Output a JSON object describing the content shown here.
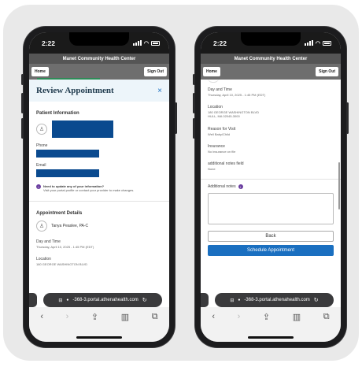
{
  "left": {
    "time": "2:22",
    "app_title": "Manet Community Health Center",
    "home": "Home",
    "sign_out": "Sign Out",
    "review_title": "Review Appointment",
    "close": "×",
    "patient_info": "Patient Information",
    "phone_label": "Phone",
    "email_label": "Email",
    "update_bold": "Need to update any of your information?",
    "update_rest": "Visit your portal profile or contact your provider to make changes.",
    "appt_details": "Appointment Details",
    "provider": "Tanya Peaslee, PA-C",
    "dt_label": "Day and Time",
    "dt_value": "Thursday, April 10, 2025 - 1:45 PM (EDT)",
    "loc_label": "Location",
    "loc_value": "180 GEORGE WASHINGTON BLVD",
    "url": "-368-3.portal.athenahealth.com"
  },
  "right": {
    "time": "2:22",
    "app_title": "Manet Community Health Center",
    "home": "Home",
    "sign_out": "Sign Out",
    "dt_label": "Day and Time",
    "dt_value": "Thursday, April 10, 2025 - 1:45 PM (EDT)",
    "loc_label": "Location",
    "loc_line1": "180 GEORGE WASHINGTON BLVD",
    "loc_line2": "HULL, MA 02045-3000",
    "reason_label": "Reason for Visit",
    "reason_value": "Well Baby/Child",
    "ins_label": "Insurance",
    "ins_value": "No insurance on file",
    "notes_field_label": "additional notes field",
    "notes_field_value": "None",
    "notes_label": "Additional notes",
    "back": "Back",
    "schedule": "Schedule Appointment",
    "url": "-368-3.portal.athenahealth.com"
  },
  "toolbar_icons": [
    "back-icon",
    "forward-icon",
    "share-icon",
    "bookmarks-icon",
    "tabs-icon"
  ]
}
